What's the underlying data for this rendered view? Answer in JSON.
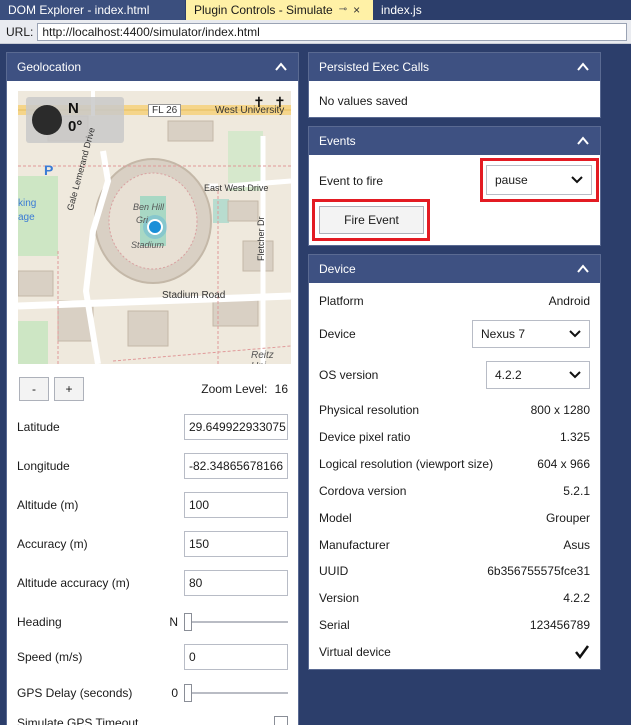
{
  "tabs": [
    {
      "label": "DOM Explorer - index.html"
    },
    {
      "label": "Plugin Controls - Simulate",
      "pin": "⊸",
      "close": "×"
    },
    {
      "label": "index.js"
    }
  ],
  "url": {
    "label": "URL:",
    "value": "http://localhost:4400/simulator/index.html"
  },
  "geolocation": {
    "title": "Geolocation",
    "compass": {
      "direction": "N",
      "degrees": "0°"
    },
    "map_labels": {
      "fl26": "FL 26",
      "west_university": "West University",
      "east_west_drive": "East West Drive",
      "gale_lemerand": "Gale Lemerand Drive",
      "fletcher": "Fletcher Dr",
      "ben_hill": "Ben Hill",
      "gri": "Gri",
      "stadium": "Stadium",
      "stadium_road": "Stadium Road",
      "reitz": "Reitz Uni",
      "p": "P",
      "king": "king",
      "age": "age"
    },
    "zoom_out": "-",
    "zoom_in": "+",
    "zoom_label": "Zoom Level:",
    "zoom_value": "16",
    "latitude_label": "Latitude",
    "latitude_value": "29.649922933075",
    "longitude_label": "Longitude",
    "longitude_value": "-82.34865678166",
    "altitude_label": "Altitude (m)",
    "altitude_value": "100",
    "accuracy_label": "Accuracy (m)",
    "accuracy_value": "150",
    "alt_accuracy_label": "Altitude accuracy (m)",
    "alt_accuracy_value": "80",
    "heading_label": "Heading",
    "heading_value": "N",
    "speed_label": "Speed (m/s)",
    "speed_value": "0",
    "gps_delay_label": "GPS Delay (seconds)",
    "gps_delay_value": "0",
    "gps_timeout_label": "Simulate GPS Timeout"
  },
  "exec_calls": {
    "title": "Persisted Exec Calls",
    "empty": "No values saved"
  },
  "events": {
    "title": "Events",
    "label": "Event to fire",
    "selected": "pause",
    "fire_button": "Fire Event"
  },
  "device": {
    "title": "Device",
    "platform_label": "Platform",
    "platform_value": "Android",
    "device_label": "Device",
    "device_value": "Nexus 7",
    "os_label": "OS version",
    "os_value": "4.2.2",
    "phys_res_label": "Physical resolution",
    "phys_res_value": "800 x 1280",
    "pixel_ratio_label": "Device pixel ratio",
    "pixel_ratio_value": "1.325",
    "logical_res_label": "Logical resolution (viewport size)",
    "logical_res_value": "604 x 966",
    "cordova_label": "Cordova version",
    "cordova_value": "5.2.1",
    "model_label": "Model",
    "model_value": "Grouper",
    "manufacturer_label": "Manufacturer",
    "manufacturer_value": "Asus",
    "uuid_label": "UUID",
    "uuid_value": "6b356755575fce31",
    "version_label": "Version",
    "version_value": "4.2.2",
    "serial_label": "Serial",
    "serial_value": "123456789",
    "virtual_label": "Virtual device",
    "virtual_checked": true
  },
  "colors": {
    "header": "#3e5182",
    "background": "#2c3e6b",
    "highlight": "#e31b23",
    "active_tab": "#fff1a6"
  }
}
